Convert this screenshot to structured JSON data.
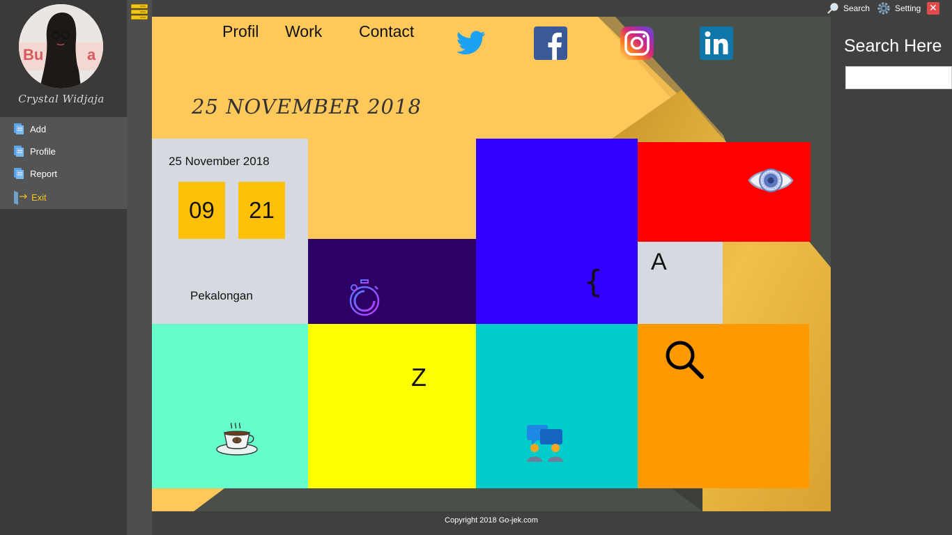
{
  "sidebar": {
    "user_name": "Crystal Widjaja",
    "menu": [
      {
        "label": "Add",
        "icon": "document-icon"
      },
      {
        "label": "Profile",
        "icon": "document-icon"
      },
      {
        "label": "Report",
        "icon": "document-icon"
      },
      {
        "label": "Exit",
        "icon": "exit-door-icon"
      }
    ]
  },
  "topbar": {
    "search_label": "Search",
    "setting_label": "Setting",
    "close_glyph": "✕"
  },
  "nav": {
    "profil": "Profil",
    "work": "Work",
    "contact": "Contact"
  },
  "social": [
    "twitter-icon",
    "facebook-icon",
    "instagram-icon",
    "linkedin-icon"
  ],
  "heading_date": "25 NOVEMBER 2018",
  "date_tile": {
    "date": "25 November 2018",
    "hour": "09",
    "minute": "21",
    "city": "Pekalongan"
  },
  "tiles": {
    "brace": "{",
    "letter_a": "A",
    "letter_z": "Z"
  },
  "footer": "Copyright 2018 Go-jek.com",
  "right_panel": {
    "title": "Search Here",
    "input_value": "",
    "placeholder": ""
  },
  "colors": {
    "main_bg": "#ffc85a",
    "accent_yellow": "#ffc107",
    "blue_tile": "#3300ff",
    "red_tile": "#ff0000",
    "purple_tile": "#2d0066",
    "mint_tile": "#66ffcc",
    "yellow_tile": "#ffff00",
    "teal_tile": "#00cccc",
    "orange_tile": "#ff9900",
    "gray_tile": "#d7d9e0"
  }
}
